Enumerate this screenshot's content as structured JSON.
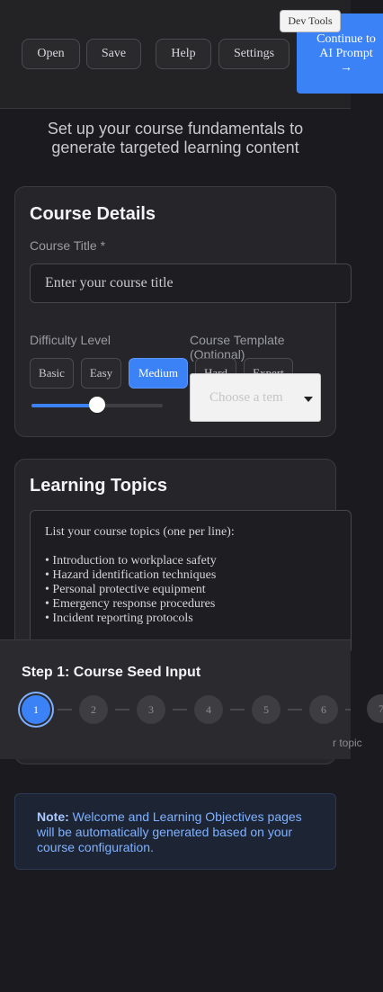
{
  "toolbar": {
    "buttons": [
      "Open",
      "Save",
      "Help",
      "Settings"
    ],
    "dev_tools": "Dev Tools",
    "continue": "Continue to AI Prompt →"
  },
  "header": {
    "subtitle": "Set up your course fundamentals to generate targeted learning content"
  },
  "course_details": {
    "title": "Course Details",
    "course_title_label": "Course Title *",
    "course_title_placeholder": "Enter your course title",
    "difficulty_label": "Difficulty Level",
    "difficulty_options": [
      "Basic",
      "Easy",
      "Medium",
      "Hard",
      "Expert"
    ],
    "difficulty_selected": "Medium",
    "difficulty_level_fraction": 0.5,
    "template_label": "Course Template (Optional)",
    "template_placeholder": "Choose a tem"
  },
  "learning_topics": {
    "title": "Learning Topics",
    "intro": "List your course topics (one per line):",
    "topics": [
      "• Introduction to workplace safety",
      "• Hazard identification techniques",
      "• Personal protective equipment",
      "• Emergency response procedures",
      "• Incident reporting protocols"
    ]
  },
  "steps": {
    "title": "Step 1: Course Seed Input",
    "items": [
      "1",
      "2",
      "3",
      "4",
      "5",
      "6",
      "7"
    ],
    "active": "1"
  },
  "clipped_text": "r topic",
  "note": {
    "label": "Note:",
    "text": " Welcome and Learning Objectives pages will be automatically generated based on your course configuration."
  },
  "colors": {
    "accent": "#3b82f6",
    "background": "#1b1b1f",
    "card": "#25252a",
    "note_bg": "#1d2535"
  }
}
